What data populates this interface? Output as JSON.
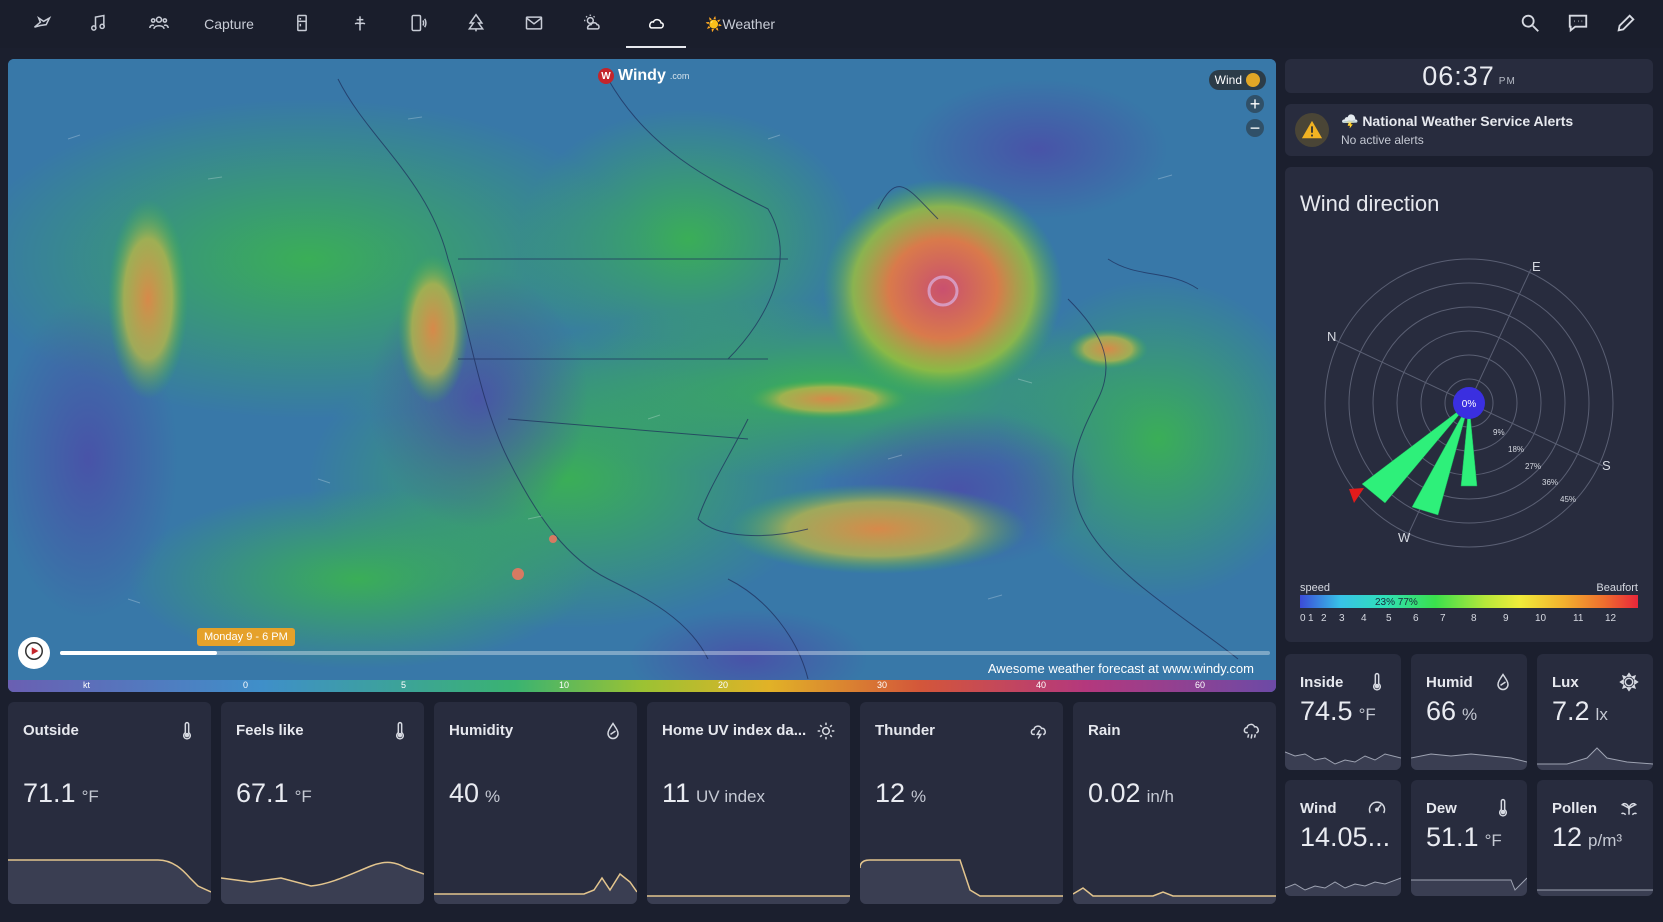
{
  "nav": {
    "tabs": [
      {
        "icon": "bird-icon",
        "label": ""
      },
      {
        "icon": "music-icon",
        "label": ""
      },
      {
        "icon": "people-icon",
        "label": ""
      },
      {
        "icon": "",
        "label": "Capture"
      },
      {
        "icon": "fridge-icon",
        "label": ""
      },
      {
        "icon": "sprinkler-icon",
        "label": ""
      },
      {
        "icon": "tablet-sound-icon",
        "label": ""
      },
      {
        "icon": "pine-tree-icon",
        "label": ""
      },
      {
        "icon": "mail-icon",
        "label": ""
      },
      {
        "icon": "weather-partly-sunny-icon",
        "label": ""
      },
      {
        "icon": "cloud-icon",
        "label": ""
      },
      {
        "icon": "",
        "label": "☀️Weather"
      }
    ],
    "active_index": 10,
    "right_icons": [
      "search-icon",
      "chat-icon",
      "pencil-icon"
    ]
  },
  "map": {
    "brand": "Windy",
    "brand_suffix": ".com",
    "layer": "Wind",
    "zoom_in": "+",
    "zoom_out": "−",
    "timestamp_label": "Monday 9 - 6 PM",
    "timeline_progress": 0.13,
    "credit": "Awesome weather forecast at www.windy.com",
    "scale_unit": "kt",
    "scale_ticks": [
      "0",
      "5",
      "10",
      "20",
      "30",
      "40",
      "60"
    ]
  },
  "clock": {
    "time": "06:37",
    "ampm": "PM"
  },
  "alerts": {
    "title": "🌩️ National Weather Service Alerts",
    "subtitle": "No active alerts"
  },
  "wind_direction": {
    "title": "Wind direction",
    "center_label": "0%",
    "compass": [
      "N",
      "E",
      "S",
      "W"
    ],
    "ring_labels": [
      "9%",
      "18%",
      "27%",
      "36%",
      "45%"
    ],
    "legend_left": "speed",
    "legend_right": "Beaufort",
    "legend_pct": "23% 77%",
    "beaufort_ticks": [
      "0",
      "1",
      "2",
      "3",
      "4",
      "5",
      "6",
      "7",
      "8",
      "9",
      "10",
      "11",
      "12"
    ],
    "colors": {
      "petal": "#2ef07a",
      "center": "#3a2fe0",
      "arrow": "#e21b1b"
    }
  },
  "sensors_main": [
    {
      "label": "Outside",
      "value": "71.1",
      "unit": "°F",
      "icon": "thermometer-icon"
    },
    {
      "label": "Feels like",
      "value": "67.1",
      "unit": "°F",
      "icon": "thermometer-icon"
    },
    {
      "label": "Humidity",
      "value": "40",
      "unit": "%",
      "icon": "water-drop-icon"
    },
    {
      "label": "Home UV index da...",
      "value": "11",
      "unit": "UV index",
      "icon": "sun-icon"
    },
    {
      "label": "Thunder",
      "value": "12",
      "unit": "%",
      "icon": "cloud-lightning-icon"
    },
    {
      "label": "Rain",
      "value": "0.02",
      "unit": "in/h",
      "icon": "cloud-rain-icon"
    }
  ],
  "sensors_side": [
    {
      "label": "Inside",
      "value": "74.5",
      "unit": "°F",
      "icon": "thermometer-icon"
    },
    {
      "label": "Humid",
      "value": "66",
      "unit": "%",
      "icon": "water-drop-icon"
    },
    {
      "label": "Lux",
      "value": "7.2",
      "unit": "lx",
      "icon": "brightness-icon"
    },
    {
      "label": "Wind",
      "value": "14.05...",
      "unit": "",
      "icon": "gauge-icon"
    },
    {
      "label": "Dew",
      "value": "51.1",
      "unit": "°F",
      "icon": "thermometer-icon"
    },
    {
      "label": "Pollen",
      "value": "12",
      "unit": "p/m³",
      "icon": "flower-icon"
    }
  ]
}
